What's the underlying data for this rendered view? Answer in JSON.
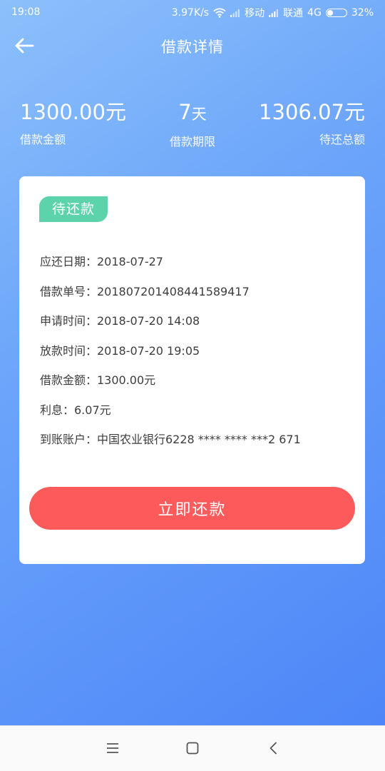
{
  "status_bar": {
    "time": "19:08",
    "speed": "3.97K/s",
    "carrier1": "移动",
    "carrier2": "联通",
    "network": "4G",
    "battery_text": "32%",
    "battery_level": 0.32
  },
  "header": {
    "title": "借款详情",
    "back_icon": "arrow-left-icon"
  },
  "summary": {
    "loan_amount": {
      "value": "1300.00",
      "unit": "元",
      "label": "借款金额"
    },
    "loan_term": {
      "value": "7",
      "unit": "天",
      "label": "借款期限"
    },
    "total_due": {
      "value": "1306.07",
      "unit": "元",
      "label": "待还总额"
    }
  },
  "card": {
    "status_badge": "待还款",
    "details": [
      "应还日期：2018-07-27",
      "借款单号：20180720140844158941​7",
      "申请时间：2018-07-20 14:08",
      "放款时间：2018-07-20 19:05",
      "借款金额：1300.00元",
      "利息：6.07元",
      "到账账户：中国农业银行6228 **** **** ***2 671"
    ],
    "repay_button": "立即还款"
  },
  "colors": {
    "gradient_start": "#8cc0fb",
    "gradient_end": "#4d86f8",
    "badge": "#5cd3aa",
    "button": "#fd5b5b"
  },
  "nav_bar": {
    "menu_icon": "menu-icon",
    "home_icon": "square-home-icon",
    "back_icon": "chevron-left-icon"
  }
}
